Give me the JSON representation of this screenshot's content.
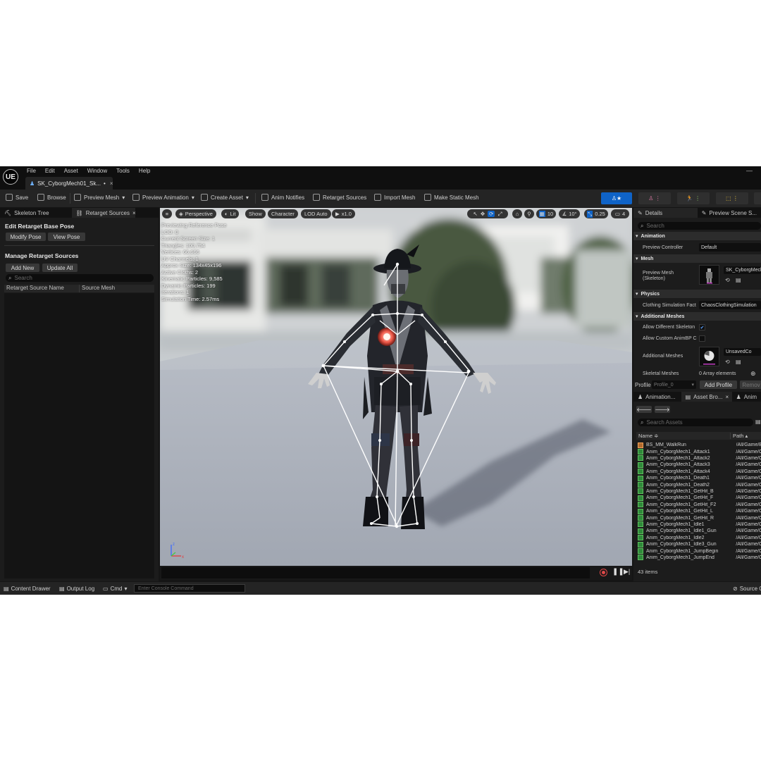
{
  "menubar": {
    "items": [
      "File",
      "Edit",
      "Asset",
      "Window",
      "Tools",
      "Help"
    ],
    "logo": "UE"
  },
  "tabbar": {
    "doc_tab": "SK_CyborgMech01_Sk...",
    "dirty_marker": "•",
    "close": "×"
  },
  "toolbar": {
    "save": "Save",
    "browse": "Browse",
    "preview_mesh": "Preview Mesh",
    "preview_animation": "Preview Animation",
    "create_asset": "Create Asset",
    "anim_notifies": "Anim Notifies",
    "retarget_sources": "Retarget Sources",
    "import_mesh": "Import Mesh",
    "make_static_mesh": "Make Static Mesh"
  },
  "left_panel": {
    "tabs": [
      "Skeleton Tree",
      "Retarget Sources"
    ],
    "edit_retarget_title": "Edit Retarget Base Pose",
    "modify_pose": "Modify Pose",
    "view_pose": "View Pose",
    "manage_title": "Manage Retarget Sources",
    "add_new": "Add New",
    "update_all": "Update All",
    "search_placeholder": "Search",
    "columns": [
      "Retarget Source Name",
      "Source Mesh"
    ]
  },
  "viewport": {
    "perspective": "Perspective",
    "lit": "Lit",
    "show": "Show",
    "character": "Character",
    "lod": "LOD Auto",
    "play_rate": "x1.0",
    "grid_value": "10",
    "angle_value": "10°",
    "scale_value": "0.25",
    "camera_speed": "4",
    "stats": [
      "Previewing Reference Pose",
      "LOD: 0",
      "Current Screen Size: 1",
      "Triangles: 100,754",
      "Vertices: 66,666",
      "UV Channels: 1",
      "Approx Size: 134x45x196",
      "Active Cloths: 2",
      "Kinematic Particles: 9,585",
      "Dynamic Particles: 199",
      "Iterations: 1",
      "Simulation Time: 2.57ms"
    ]
  },
  "details": {
    "tabs": [
      "Details",
      "Preview Scene S..."
    ],
    "search_placeholder": "Search",
    "animation_cat": "Animation",
    "preview_controller_label": "Preview Controller",
    "preview_controller_value": "Default",
    "mesh_cat": "Mesh",
    "preview_mesh_label_1": "Preview Mesh",
    "preview_mesh_label_2": "(Skeleton)",
    "preview_mesh_value": "SK_CyborgMech",
    "physics_cat": "Physics",
    "clothing_label": "Clothing Simulation Fact",
    "clothing_value": "ChaosClothingSimulation",
    "additional_cat": "Additional Meshes",
    "allow_diff_skel": "Allow Different Skeleton",
    "allow_custom_animbp": "Allow Custom AnimBP C",
    "additional_meshes_label": "Additional Meshes",
    "additional_meshes_value": "UnsavedCo",
    "skeletal_meshes_label": "Skeletal Meshes",
    "skeletal_meshes_value": "0 Array elements",
    "profile_label": "Profile",
    "profile_value": "Profile_0",
    "add_profile": "Add Profile",
    "remove_profile": "Remov"
  },
  "asset_browser": {
    "tabs": [
      "Animation...",
      "Asset Bro...",
      "Anim"
    ],
    "search_placeholder": "Search Assets",
    "col_name": "Name",
    "col_path": "Path",
    "rows": [
      {
        "name": "BS_MM_WalkRun",
        "path": "/All/Game/B",
        "kind": "blendspace"
      },
      {
        "name": "Anim_CyborgMech1_Attack1",
        "path": "/All/Game/C",
        "kind": "anim"
      },
      {
        "name": "Anim_CyborgMech1_Attack2",
        "path": "/All/Game/C",
        "kind": "anim"
      },
      {
        "name": "Anim_CyborgMech1_Attack3",
        "path": "/All/Game/C",
        "kind": "anim"
      },
      {
        "name": "Anim_CyborgMech1_Attack4",
        "path": "/All/Game/C",
        "kind": "anim"
      },
      {
        "name": "Anim_CyborgMech1_Death1",
        "path": "/All/Game/C",
        "kind": "anim"
      },
      {
        "name": "Anim_CyborgMech1_Death2",
        "path": "/All/Game/C",
        "kind": "anim"
      },
      {
        "name": "Anim_CyborgMech1_GetHit_B",
        "path": "/All/Game/C",
        "kind": "anim"
      },
      {
        "name": "Anim_CyborgMech1_GetHit_F",
        "path": "/All/Game/C",
        "kind": "anim"
      },
      {
        "name": "Anim_CyborgMech1_GetHit_F2",
        "path": "/All/Game/C",
        "kind": "anim"
      },
      {
        "name": "Anim_CyborgMech1_GetHit_L",
        "path": "/All/Game/C",
        "kind": "anim"
      },
      {
        "name": "Anim_CyborgMech1_GetHit_R",
        "path": "/All/Game/C",
        "kind": "anim"
      },
      {
        "name": "Anim_CyborgMech1_Idle1",
        "path": "/All/Game/C",
        "kind": "anim"
      },
      {
        "name": "Anim_CyborgMech1_Idle1_Gun",
        "path": "/All/Game/C",
        "kind": "anim"
      },
      {
        "name": "Anim_CyborgMech1_Idle2",
        "path": "/All/Game/C",
        "kind": "anim"
      },
      {
        "name": "Anim_CyborgMech1_Idle3_Gun",
        "path": "/All/Game/C",
        "kind": "anim"
      },
      {
        "name": "Anim_CyborgMech1_JumpBegin",
        "path": "/All/Game/C",
        "kind": "anim"
      },
      {
        "name": "Anim_CyborgMech1_JumpEnd",
        "path": "/All/Game/C",
        "kind": "anim"
      }
    ],
    "item_count": "43 items"
  },
  "bottombar": {
    "content_drawer": "Content Drawer",
    "output_log": "Output Log",
    "cmd": "Cmd",
    "console_placeholder": "Enter Console Command",
    "source": "Source C"
  },
  "colors": {
    "accent_blue": "#0f63c7",
    "panel_bg": "#1c1c1c",
    "toolbar_bg": "#242424"
  }
}
